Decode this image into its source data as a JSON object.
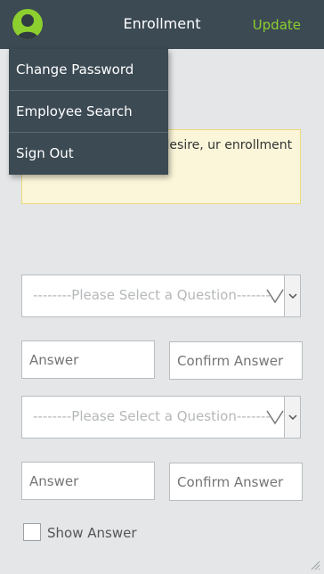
{
  "header": {
    "title": "Enrollment",
    "update_label": "Update"
  },
  "menu": {
    "items": [
      {
        "label": "Change Password"
      },
      {
        "label": "Employee Search"
      },
      {
        "label": "Sign Out"
      }
    ]
  },
  "notice": {
    "text": "enrolled! If you desire, ur enrollment information here"
  },
  "question_1": {
    "placeholder": "--------Please Select a Question-------",
    "answer_placeholder": "Answer",
    "confirm_placeholder": "Confirm Answer"
  },
  "question_2": {
    "placeholder": "--------Please Select a Question-------",
    "answer_placeholder": "Answer",
    "confirm_placeholder": "Confirm Answer"
  },
  "show_answer": {
    "label": "Show Answer",
    "checked": false
  },
  "colors": {
    "header_bg": "#3c4a54",
    "accent": "#8ccf2f",
    "notice_bg": "#fbf6d9",
    "notice_border": "#f0d97a"
  }
}
